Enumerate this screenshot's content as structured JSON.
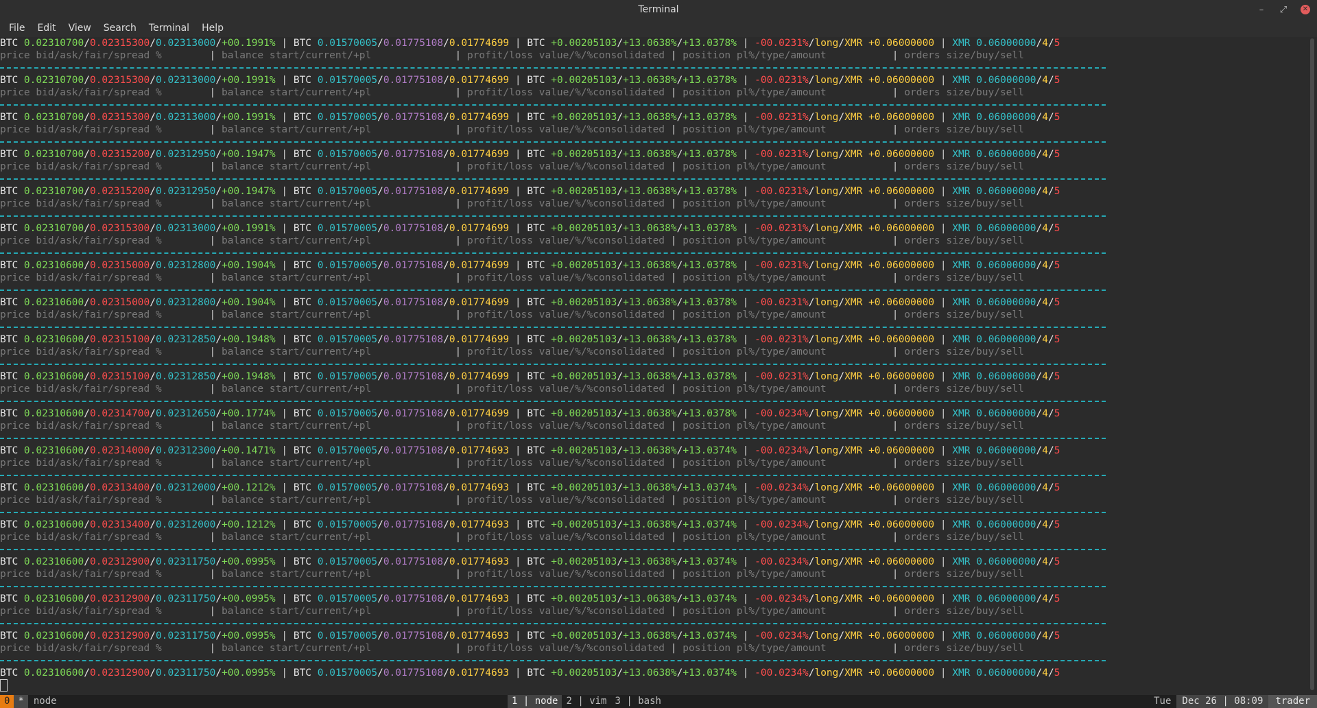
{
  "window": {
    "title": "Terminal"
  },
  "menu": [
    "File",
    "Edit",
    "View",
    "Search",
    "Terminal",
    "Help"
  ],
  "labels": {
    "price": "price bid/ask/fair/spread %",
    "balance": "balance start/current/+pl",
    "pnl": "profit/loss value/%/%consolidated",
    "position": "position pl%/type/amount",
    "orders": "orders size/buy/sell"
  },
  "rows": [
    {
      "bid": "0.02310700",
      "ask": "0.02315300",
      "fair": "0.02313000",
      "spread": "+00.1991%",
      "bal_start": "0.01570005",
      "bal_cur": "0.01775108",
      "bal_pl": "0.01774699",
      "pl_val": "+0.00205103",
      "pl_pct": "+13.0638%",
      "pl_cons": "+13.0378%",
      "pos_pl": "-00.0231%",
      "pos_type": "long",
      "pos_asset": "XMR",
      "pos_amt": "+0.06000000",
      "ord_size": "0.06000000",
      "ord_buy": "4",
      "ord_sell": "5"
    },
    {
      "bid": "0.02310700",
      "ask": "0.02315300",
      "fair": "0.02313000",
      "spread": "+00.1991%",
      "bal_start": "0.01570005",
      "bal_cur": "0.01775108",
      "bal_pl": "0.01774699",
      "pl_val": "+0.00205103",
      "pl_pct": "+13.0638%",
      "pl_cons": "+13.0378%",
      "pos_pl": "-00.0231%",
      "pos_type": "long",
      "pos_asset": "XMR",
      "pos_amt": "+0.06000000",
      "ord_size": "0.06000000",
      "ord_buy": "4",
      "ord_sell": "5"
    },
    {
      "bid": "0.02310700",
      "ask": "0.02315300",
      "fair": "0.02313000",
      "spread": "+00.1991%",
      "bal_start": "0.01570005",
      "bal_cur": "0.01775108",
      "bal_pl": "0.01774699",
      "pl_val": "+0.00205103",
      "pl_pct": "+13.0638%",
      "pl_cons": "+13.0378%",
      "pos_pl": "-00.0231%",
      "pos_type": "long",
      "pos_asset": "XMR",
      "pos_amt": "+0.06000000",
      "ord_size": "0.06000000",
      "ord_buy": "4",
      "ord_sell": "5"
    },
    {
      "bid": "0.02310700",
      "ask": "0.02315200",
      "fair": "0.02312950",
      "spread": "+00.1947%",
      "bal_start": "0.01570005",
      "bal_cur": "0.01775108",
      "bal_pl": "0.01774699",
      "pl_val": "+0.00205103",
      "pl_pct": "+13.0638%",
      "pl_cons": "+13.0378%",
      "pos_pl": "-00.0231%",
      "pos_type": "long",
      "pos_asset": "XMR",
      "pos_amt": "+0.06000000",
      "ord_size": "0.06000000",
      "ord_buy": "4",
      "ord_sell": "5"
    },
    {
      "bid": "0.02310700",
      "ask": "0.02315200",
      "fair": "0.02312950",
      "spread": "+00.1947%",
      "bal_start": "0.01570005",
      "bal_cur": "0.01775108",
      "bal_pl": "0.01774699",
      "pl_val": "+0.00205103",
      "pl_pct": "+13.0638%",
      "pl_cons": "+13.0378%",
      "pos_pl": "-00.0231%",
      "pos_type": "long",
      "pos_asset": "XMR",
      "pos_amt": "+0.06000000",
      "ord_size": "0.06000000",
      "ord_buy": "4",
      "ord_sell": "5"
    },
    {
      "bid": "0.02310700",
      "ask": "0.02315300",
      "fair": "0.02313000",
      "spread": "+00.1991%",
      "bal_start": "0.01570005",
      "bal_cur": "0.01775108",
      "bal_pl": "0.01774699",
      "pl_val": "+0.00205103",
      "pl_pct": "+13.0638%",
      "pl_cons": "+13.0378%",
      "pos_pl": "-00.0231%",
      "pos_type": "long",
      "pos_asset": "XMR",
      "pos_amt": "+0.06000000",
      "ord_size": "0.06000000",
      "ord_buy": "4",
      "ord_sell": "5"
    },
    {
      "bid": "0.02310600",
      "ask": "0.02315000",
      "fair": "0.02312800",
      "spread": "+00.1904%",
      "bal_start": "0.01570005",
      "bal_cur": "0.01775108",
      "bal_pl": "0.01774699",
      "pl_val": "+0.00205103",
      "pl_pct": "+13.0638%",
      "pl_cons": "+13.0378%",
      "pos_pl": "-00.0231%",
      "pos_type": "long",
      "pos_asset": "XMR",
      "pos_amt": "+0.06000000",
      "ord_size": "0.06000000",
      "ord_buy": "4",
      "ord_sell": "5"
    },
    {
      "bid": "0.02310600",
      "ask": "0.02315000",
      "fair": "0.02312800",
      "spread": "+00.1904%",
      "bal_start": "0.01570005",
      "bal_cur": "0.01775108",
      "bal_pl": "0.01774699",
      "pl_val": "+0.00205103",
      "pl_pct": "+13.0638%",
      "pl_cons": "+13.0378%",
      "pos_pl": "-00.0231%",
      "pos_type": "long",
      "pos_asset": "XMR",
      "pos_amt": "+0.06000000",
      "ord_size": "0.06000000",
      "ord_buy": "4",
      "ord_sell": "5"
    },
    {
      "bid": "0.02310600",
      "ask": "0.02315100",
      "fair": "0.02312850",
      "spread": "+00.1948%",
      "bal_start": "0.01570005",
      "bal_cur": "0.01775108",
      "bal_pl": "0.01774699",
      "pl_val": "+0.00205103",
      "pl_pct": "+13.0638%",
      "pl_cons": "+13.0378%",
      "pos_pl": "-00.0231%",
      "pos_type": "long",
      "pos_asset": "XMR",
      "pos_amt": "+0.06000000",
      "ord_size": "0.06000000",
      "ord_buy": "4",
      "ord_sell": "5"
    },
    {
      "bid": "0.02310600",
      "ask": "0.02315100",
      "fair": "0.02312850",
      "spread": "+00.1948%",
      "bal_start": "0.01570005",
      "bal_cur": "0.01775108",
      "bal_pl": "0.01774699",
      "pl_val": "+0.00205103",
      "pl_pct": "+13.0638%",
      "pl_cons": "+13.0378%",
      "pos_pl": "-00.0231%",
      "pos_type": "long",
      "pos_asset": "XMR",
      "pos_amt": "+0.06000000",
      "ord_size": "0.06000000",
      "ord_buy": "4",
      "ord_sell": "5"
    },
    {
      "bid": "0.02310600",
      "ask": "0.02314700",
      "fair": "0.02312650",
      "spread": "+00.1774%",
      "bal_start": "0.01570005",
      "bal_cur": "0.01775108",
      "bal_pl": "0.01774699",
      "pl_val": "+0.00205103",
      "pl_pct": "+13.0638%",
      "pl_cons": "+13.0378%",
      "pos_pl": "-00.0234%",
      "pos_type": "long",
      "pos_asset": "XMR",
      "pos_amt": "+0.06000000",
      "ord_size": "0.06000000",
      "ord_buy": "4",
      "ord_sell": "5"
    },
    {
      "bid": "0.02310600",
      "ask": "0.02314000",
      "fair": "0.02312300",
      "spread": "+00.1471%",
      "bal_start": "0.01570005",
      "bal_cur": "0.01775108",
      "bal_pl": "0.01774693",
      "pl_val": "+0.00205103",
      "pl_pct": "+13.0638%",
      "pl_cons": "+13.0374%",
      "pos_pl": "-00.0234%",
      "pos_type": "long",
      "pos_asset": "XMR",
      "pos_amt": "+0.06000000",
      "ord_size": "0.06000000",
      "ord_buy": "4",
      "ord_sell": "5"
    },
    {
      "bid": "0.02310600",
      "ask": "0.02313400",
      "fair": "0.02312000",
      "spread": "+00.1212%",
      "bal_start": "0.01570005",
      "bal_cur": "0.01775108",
      "bal_pl": "0.01774693",
      "pl_val": "+0.00205103",
      "pl_pct": "+13.0638%",
      "pl_cons": "+13.0374%",
      "pos_pl": "-00.0234%",
      "pos_type": "long",
      "pos_asset": "XMR",
      "pos_amt": "+0.06000000",
      "ord_size": "0.06000000",
      "ord_buy": "4",
      "ord_sell": "5"
    },
    {
      "bid": "0.02310600",
      "ask": "0.02313400",
      "fair": "0.02312000",
      "spread": "+00.1212%",
      "bal_start": "0.01570005",
      "bal_cur": "0.01775108",
      "bal_pl": "0.01774693",
      "pl_val": "+0.00205103",
      "pl_pct": "+13.0638%",
      "pl_cons": "+13.0374%",
      "pos_pl": "-00.0234%",
      "pos_type": "long",
      "pos_asset": "XMR",
      "pos_amt": "+0.06000000",
      "ord_size": "0.06000000",
      "ord_buy": "4",
      "ord_sell": "5"
    },
    {
      "bid": "0.02310600",
      "ask": "0.02312900",
      "fair": "0.02311750",
      "spread": "+00.0995%",
      "bal_start": "0.01570005",
      "bal_cur": "0.01775108",
      "bal_pl": "0.01774693",
      "pl_val": "+0.00205103",
      "pl_pct": "+13.0638%",
      "pl_cons": "+13.0374%",
      "pos_pl": "-00.0234%",
      "pos_type": "long",
      "pos_asset": "XMR",
      "pos_amt": "+0.06000000",
      "ord_size": "0.06000000",
      "ord_buy": "4",
      "ord_sell": "5"
    },
    {
      "bid": "0.02310600",
      "ask": "0.02312900",
      "fair": "0.02311750",
      "spread": "+00.0995%",
      "bal_start": "0.01570005",
      "bal_cur": "0.01775108",
      "bal_pl": "0.01774693",
      "pl_val": "+0.00205103",
      "pl_pct": "+13.0638%",
      "pl_cons": "+13.0374%",
      "pos_pl": "-00.0234%",
      "pos_type": "long",
      "pos_asset": "XMR",
      "pos_amt": "+0.06000000",
      "ord_size": "0.06000000",
      "ord_buy": "4",
      "ord_sell": "5"
    },
    {
      "bid": "0.02310600",
      "ask": "0.02312900",
      "fair": "0.02311750",
      "spread": "+00.0995%",
      "bal_start": "0.01570005",
      "bal_cur": "0.01775108",
      "bal_pl": "0.01774693",
      "pl_val": "+0.00205103",
      "pl_pct": "+13.0638%",
      "pl_cons": "+13.0374%",
      "pos_pl": "-00.0234%",
      "pos_type": "long",
      "pos_asset": "XMR",
      "pos_amt": "+0.06000000",
      "ord_size": "0.06000000",
      "ord_buy": "4",
      "ord_sell": "5"
    },
    {
      "bid": "0.02310600",
      "ask": "0.02312900",
      "fair": "0.02311750",
      "spread": "+00.0995%",
      "bal_start": "0.01570005",
      "bal_cur": "0.01775108",
      "bal_pl": "0.01774693",
      "pl_val": "+0.00205103",
      "pl_pct": "+13.0638%",
      "pl_cons": "+13.0374%",
      "pos_pl": "-00.0234%",
      "pos_type": "long",
      "pos_asset": "XMR",
      "pos_amt": "+0.06000000",
      "ord_size": "0.06000000",
      "ord_buy": "4",
      "ord_sell": "5"
    }
  ],
  "status": {
    "window_num": "0",
    "flag": "*",
    "session": "node",
    "tabs": [
      {
        "num": "1",
        "name": "node",
        "active": true
      },
      {
        "num": "2",
        "name": "vim",
        "active": false
      },
      {
        "num": "3",
        "name": "bash",
        "active": false
      }
    ],
    "day": "Tue",
    "date_time": "Dec 26 | 08:09",
    "host": "trader"
  },
  "colors": {
    "separator": "#25a9b5",
    "accent_orange": "#e87c12",
    "negative": "#ff4d4d",
    "positive": "#7ed957"
  }
}
